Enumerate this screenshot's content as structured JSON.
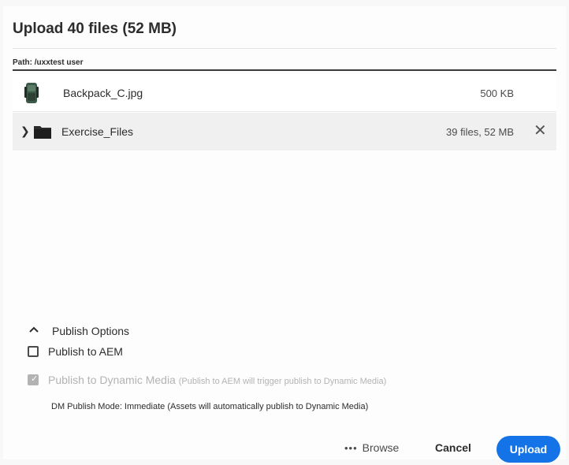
{
  "dialog": {
    "title": "Upload 40 files (52 MB)",
    "path": "Path: /uxxtest user"
  },
  "files": [
    {
      "name": "Backpack_C.jpg",
      "size": "500 KB",
      "icon": "image-thumbnail"
    },
    {
      "name": "Exercise_Files",
      "size": "39 files, 52 MB",
      "icon": "folder-icon"
    }
  ],
  "publish": {
    "toggle_label": "Publish Options",
    "aem_label": "Publish to AEM",
    "aem_checked": false,
    "dm_label": "Publish to Dynamic Media",
    "dm_note": "(Publish to AEM will trigger publish to Dynamic Media)",
    "dm_checked": true,
    "dm_mode": "DM Publish Mode:  Immediate  (Assets will automatically publish to Dynamic Media)"
  },
  "footer": {
    "browse_label": "Browse",
    "cancel_label": "Cancel",
    "upload_label": "Upload"
  },
  "colors": {
    "accent": "#1473e6",
    "disabled": "#b3b3b3"
  }
}
